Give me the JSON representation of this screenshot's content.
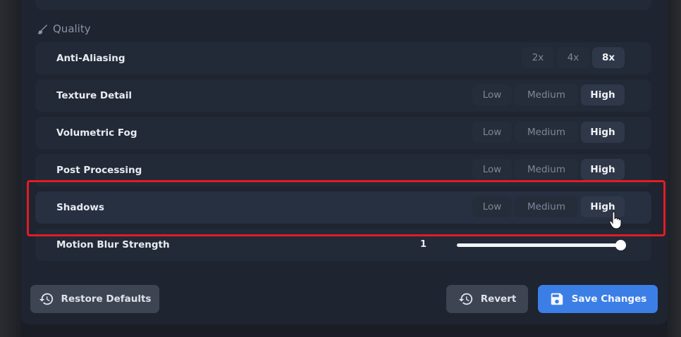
{
  "section": {
    "title": "Quality",
    "icon": "brush-icon"
  },
  "rows": [
    {
      "label": "Anti-Aliasing",
      "options": [
        "2x",
        "4x",
        "8x"
      ],
      "selected": "8x"
    },
    {
      "label": "Texture Detail",
      "options": [
        "Low",
        "Medium",
        "High"
      ],
      "selected": "High"
    },
    {
      "label": "Volumetric Fog",
      "options": [
        "Low",
        "Medium",
        "High"
      ],
      "selected": "High"
    },
    {
      "label": "Post Processing",
      "options": [
        "Low",
        "Medium",
        "High"
      ],
      "selected": "High"
    },
    {
      "label": "Shadows",
      "options": [
        "Low",
        "Medium",
        "High"
      ],
      "selected": "High"
    }
  ],
  "motion_blur": {
    "label": "Motion Blur Strength",
    "value": "1",
    "level_fraction": 1.0
  },
  "buttons": {
    "restore": {
      "label": "Restore Defaults",
      "icon": "history-icon"
    },
    "revert": {
      "label": "Revert",
      "icon": "history-icon"
    },
    "save": {
      "label": "Save Changes",
      "icon": "floppy-disk-icon"
    }
  },
  "colors": {
    "accent": "#3b7ee6",
    "highlight_border": "#e41b23",
    "panel": "#1e2430"
  }
}
